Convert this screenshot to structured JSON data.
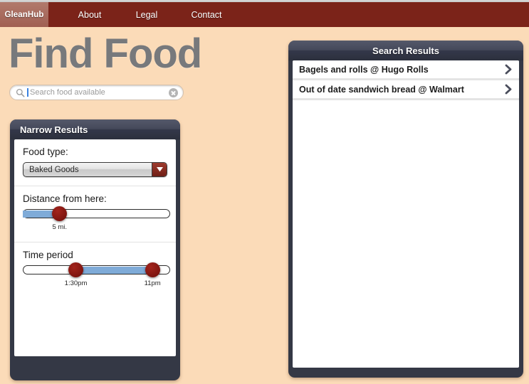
{
  "nav": {
    "brand": "GleanHub",
    "links": [
      {
        "label": "About"
      },
      {
        "label": "Legal"
      },
      {
        "label": "Contact"
      }
    ]
  },
  "page": {
    "title": "Find Food"
  },
  "search": {
    "placeholder": "Search food available",
    "value": "",
    "icon": "search-icon",
    "clear_icon": "clear-circle-icon"
  },
  "narrow_results": {
    "header": "Narrow Results",
    "food_type": {
      "label": "Food type:",
      "selected": "Baked Goods",
      "options": [
        "Baked Goods"
      ]
    },
    "distance": {
      "label": "Distance from here:",
      "value_label": "5 mi.",
      "handle_percent": 25,
      "fill_start_percent": 0,
      "fill_end_percent": 25
    },
    "time_period": {
      "label": "Time period",
      "start_label": "1:30pm",
      "end_label": "11pm",
      "start_percent": 36,
      "end_percent": 88
    }
  },
  "results": {
    "header": "Search Results",
    "rows": [
      {
        "text": "Bagels and rolls @ Hugo Rolls"
      },
      {
        "text": "Out of date sandwich bread @ Walmart"
      }
    ]
  },
  "colors": {
    "page_background": "#fbdbb8",
    "nav_background": "#7b2319",
    "brand_background": "#a8685c",
    "panel_dark": "#343845",
    "slider_fill": "#7fabd8",
    "slider_handle": "#8b1a16",
    "title_gray": "#77797c"
  }
}
